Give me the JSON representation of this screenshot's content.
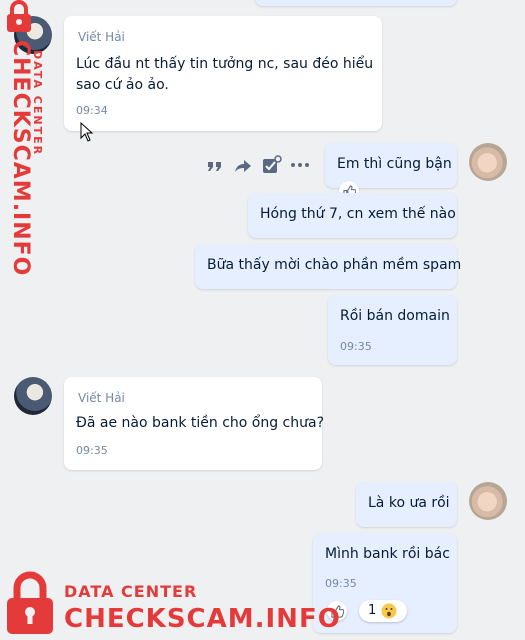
{
  "messages": [
    {
      "sender": "Viết Hải",
      "lines": [
        "Lúc đầu nt thấy tin tưởng nc, sau đéo hiểu",
        "sao cứ ảo ảo."
      ],
      "time": "09:34"
    },
    {
      "text": "Em thì cũng bận"
    },
    {
      "text": "Hóng thứ 7, cn xem thế nào"
    },
    {
      "text": "Bữa thấy mời chào phần mềm spam"
    },
    {
      "text": "Rồi bán domain",
      "time": "09:35"
    },
    {
      "sender": "Viết Hải",
      "text": "Đã ae nào bank tiền cho ổng chưa?",
      "time": "09:35"
    },
    {
      "text": "Là ko ưa rồi"
    },
    {
      "text": "Mình bank rồi bác",
      "time": "09:35",
      "reaction_count": "1"
    }
  ],
  "toolbar_icons": [
    "quote-icon",
    "forward-icon",
    "mark-task-icon",
    "more-icon"
  ],
  "watermark": {
    "small": "DATA CENTER",
    "big": "CHECKSCAM.INFO",
    "color": "#e53a3a"
  },
  "colors": {
    "incoming_bubble": "#ffffff",
    "outgoing_bubble": "#e5efff",
    "background": "#eef0f1",
    "meta_text": "#7589a3"
  }
}
